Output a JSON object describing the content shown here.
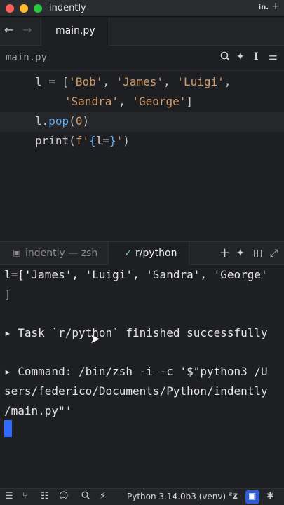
{
  "window": {
    "title": "indently",
    "badge": "in."
  },
  "tabs": {
    "active_label": "main.py"
  },
  "file_header": {
    "filename": "main.py"
  },
  "editor": {
    "line1": {
      "var": "l",
      "eq": " = [",
      "s1": "'Bob'",
      "c1": ", ",
      "s2": "'James'",
      "c2": ", ",
      "s3": "'Luigi'",
      "c3": ","
    },
    "line2": {
      "s4": "'Sandra'",
      "c4": ", ",
      "s5": "'George'",
      "close": "]"
    },
    "line3": {
      "obj": "l.",
      "method": "pop",
      "open": "(",
      "arg": "0",
      "close": ")"
    },
    "line4": {
      "fn": "print",
      "open": "(",
      "fstr1": "f'",
      "brace1": "{",
      "expr": "l=",
      "brace2": "}",
      "fstr2": "'",
      "close": ")"
    }
  },
  "terminal_tabs": {
    "tab1": "indently — zsh",
    "tab2": "r/python"
  },
  "terminal": {
    "line1": "l=['James', 'Luigi', 'Sandra', 'George'",
    "line2": "]",
    "line3": "▸ Task `r/python` finished successfully",
    "line4": "▸ Command: /bin/zsh -i -c '$\"python3 /U",
    "line5": "sers/federico/Documents/Python/indently",
    "line6": "/main.py\"'"
  },
  "status": {
    "python_version": "Python 3.14.0b3 (venv)"
  },
  "colors": {
    "accent": "#2f6bff",
    "string": "#d19a66",
    "function": "#61afef"
  }
}
